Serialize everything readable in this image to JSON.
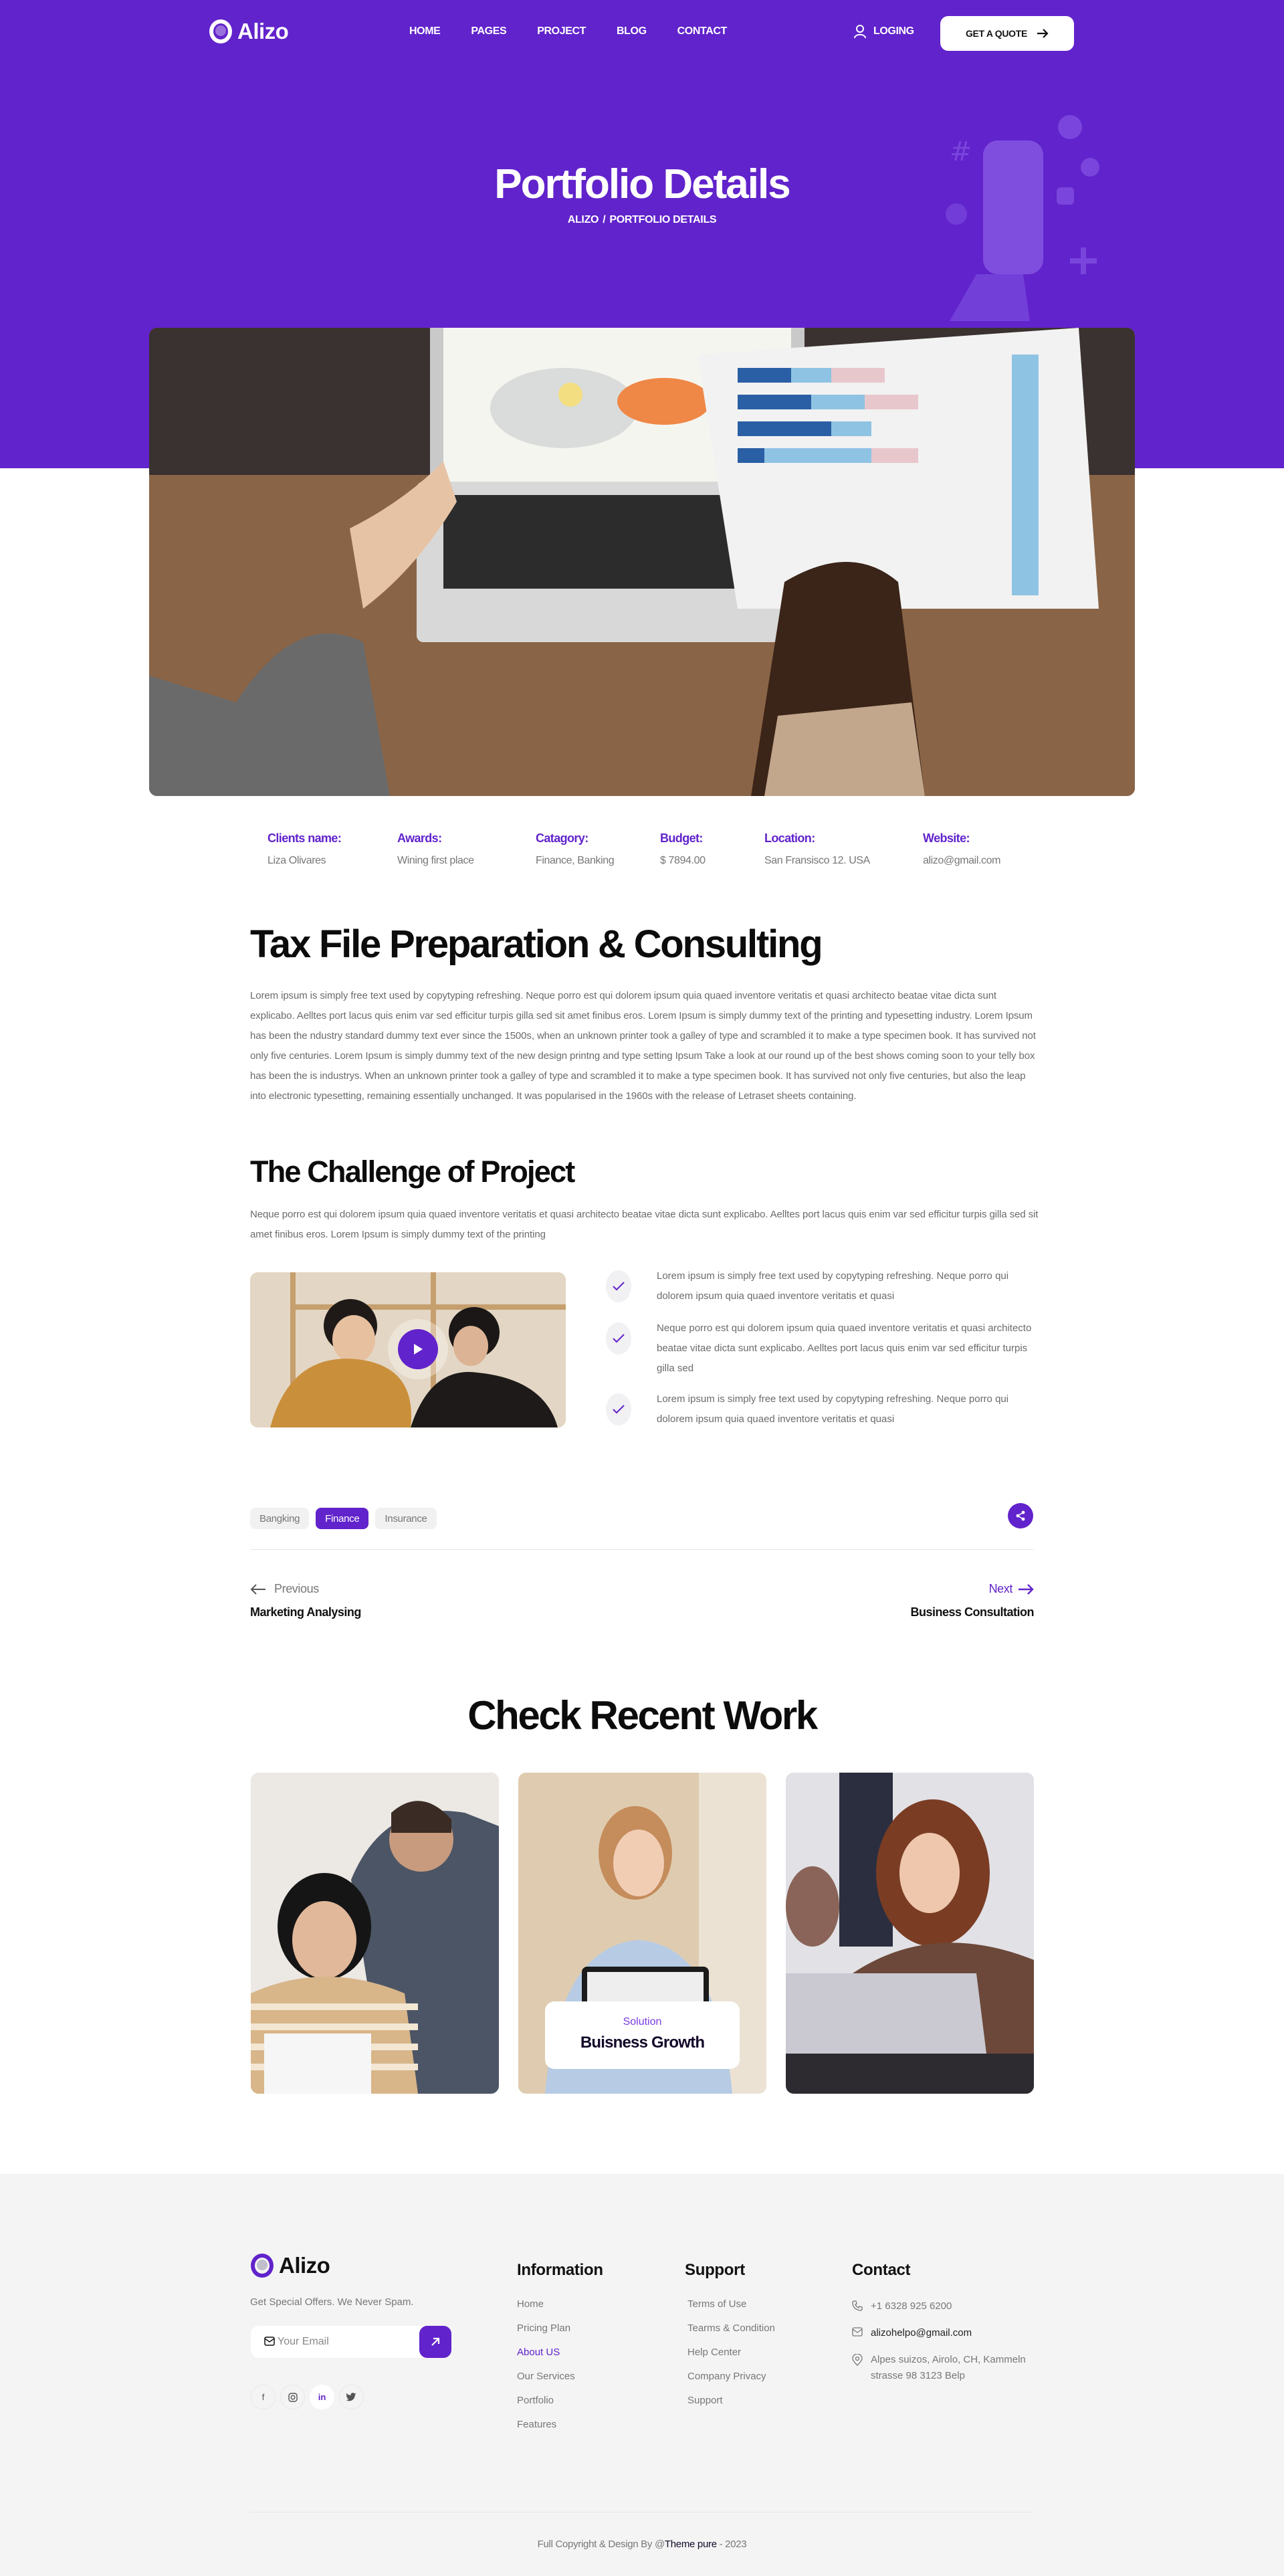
{
  "brand": {
    "name": "Alizo",
    "accent": "#6123cb"
  },
  "nav": {
    "items": [
      "HOME",
      "PAGES",
      "PROJECT",
      "BLOG",
      "CONTACT"
    ],
    "login_label": "LOGING",
    "quote_label": "GET A QUOTE"
  },
  "hero": {
    "title": "Portfolio Details",
    "breadcrumb": {
      "home": "ALIZO",
      "separator": "/",
      "current": "PORTFOLIO DETAILS"
    }
  },
  "project_info": [
    {
      "label": "Clients name:",
      "value": "Liza Olivares"
    },
    {
      "label": "Awards:",
      "value": "Wining first place"
    },
    {
      "label": "Catagory:",
      "value": "Finance, Banking"
    },
    {
      "label": "Budget:",
      "value": "$ 7894.00"
    },
    {
      "label": "Location:",
      "value": "San Fransisco 12. USA"
    },
    {
      "label": "Website:",
      "value": "alizo@gmail.com"
    }
  ],
  "content": {
    "title": "Tax File Preparation & Consulting",
    "paragraph": "Lorem ipsum is simply free text used by copytyping refreshing. Neque porro est qui dolorem ipsum quia quaed inventore veritatis et quasi architecto beatae vitae dicta sunt explicabo. Aelltes port lacus quis enim var sed efficitur turpis gilla sed sit amet finibus eros. Lorem Ipsum is simply dummy text of the printing and typesetting industry. Lorem Ipsum has been the ndustry standard dummy text ever since the 1500s, when an unknown printer took a galley of type and scrambled it to make a type specimen book. It has survived not only five centuries. Lorem Ipsum is simply dummy text of the new design printng and type setting Ipsum Take a look at our round up of the best shows coming soon to your telly box has been the is industrys. When an unknown printer took a galley of type and scrambled it to make a type specimen book. It has survived not only five centuries, but also the leap into electronic typesetting, remaining essentially unchanged. It was popularised in the 1960s with the release of Letraset sheets containing.",
    "challenge_title": "The Challenge of Project",
    "challenge_paragraph": "Neque porro est qui dolorem ipsum quia quaed inventore veritatis et quasi architecto beatae vitae dicta sunt explicabo. Aelltes port lacus quis enim var sed efficitur turpis gilla sed sit amet finibus eros. Lorem Ipsum is simply dummy text of the printing",
    "checklist": [
      "Lorem ipsum is simply free text used by copytyping refreshing. Neque porro qui dolorem ipsum quia quaed inventore veritatis et quasi",
      "Neque porro est qui dolorem ipsum quia quaed inventore veritatis et quasi architecto beatae vitae dicta sunt explicabo. Aelltes port lacus quis enim var sed efficitur turpis gilla sed",
      "Lorem ipsum is simply free text used by copytyping refreshing. Neque porro qui dolorem ipsum quia quaed inventore veritatis et quasi"
    ]
  },
  "tags": [
    {
      "label": "Bangking",
      "active": false
    },
    {
      "label": "Finance",
      "active": true
    },
    {
      "label": "Insurance",
      "active": false
    }
  ],
  "pagination": {
    "prev_label": "Previous",
    "prev_title": "Marketing Analysing",
    "next_label": "Next",
    "next_title": "Business Consultation"
  },
  "recent": {
    "title": "Check Recent Work",
    "featured": {
      "subtitle": "Solution",
      "title": "Buisness Growth"
    }
  },
  "footer": {
    "tagline": "Get Special Offers. We Never Spam.",
    "email_placeholder": "Your Email",
    "socials": [
      "f",
      "instagram",
      "in",
      "twitter"
    ],
    "information": {
      "title": "Information",
      "links": [
        "Home",
        "Pricing Plan",
        "About US",
        "Our Services",
        "Portfolio",
        "Features"
      ],
      "highlighted": "About US"
    },
    "support": {
      "title": "Support",
      "links": [
        "Terms of Use",
        "Tearms & Condition",
        "Help Center",
        "Company Privacy",
        "Support"
      ]
    },
    "contact": {
      "title": "Contact",
      "phone": "+1 6328 925 6200",
      "email": "alizohelpo@gmail.com",
      "address": "Alpes suizos, Airolo, CH, Kammeln strasse 98 3123 Belp"
    },
    "copyright_prefix": "Full Copyright & Design By @",
    "copyright_brand": "Theme pure",
    "copyright_suffix": " - 2023"
  }
}
